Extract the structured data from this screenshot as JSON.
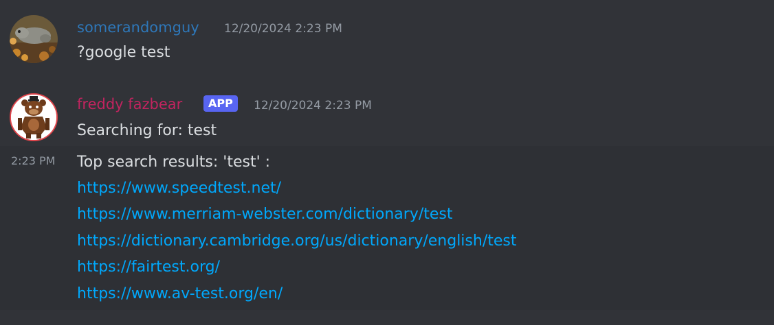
{
  "messages": [
    {
      "author": "somerandomguy",
      "author_color": "#2e77b8",
      "timestamp": "12/20/2024 2:23 PM",
      "text": "?google test"
    },
    {
      "author": "freddy fazbear",
      "author_color": "#c1245f",
      "badge": "APP",
      "timestamp": "12/20/2024 2:23 PM",
      "text": "Searching for: test"
    }
  ],
  "followup": {
    "hover_time": "2:23 PM",
    "heading": "Top search results: 'test' :",
    "links": [
      "https://www.speedtest.net/",
      "https://www.merriam-webster.com/dictionary/test",
      "https://dictionary.cambridge.org/us/dictionary/english/test",
      "https://fairtest.org/",
      "https://www.av-test.org/en/"
    ]
  },
  "colors": {
    "background": "#313338",
    "hover_background": "#2e3035",
    "link": "#00a8fc",
    "badge": "#5865f2",
    "text": "#dbdee1",
    "muted": "#949ba4"
  }
}
